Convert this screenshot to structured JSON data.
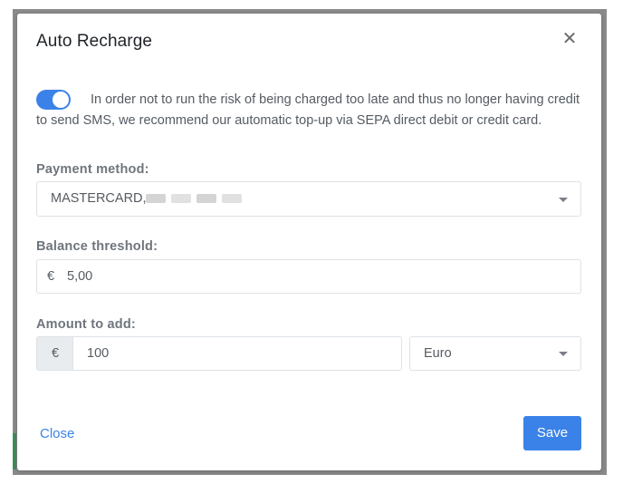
{
  "modal": {
    "title": "Auto Recharge",
    "close_icon": "close-icon",
    "info_text": "In order not to run the risk of being charged too late and thus no longer having credit to send SMS, we recommend our automatic top-up via SEPA direct debit or credit card.",
    "auto_recharge_enabled": true
  },
  "payment_method": {
    "label": "Payment method:",
    "value": "MASTERCARD,"
  },
  "balance_threshold": {
    "label": "Balance threshold:",
    "prefix": "€",
    "value": "5,00"
  },
  "amount_to_add": {
    "label": "Amount to add:",
    "prefix": "€",
    "value": "100",
    "currency": "Euro"
  },
  "footer": {
    "close_label": "Close",
    "save_label": "Save"
  },
  "colors": {
    "accent": "#3b82e8",
    "label": "#6f757c",
    "text": "#555b62"
  }
}
